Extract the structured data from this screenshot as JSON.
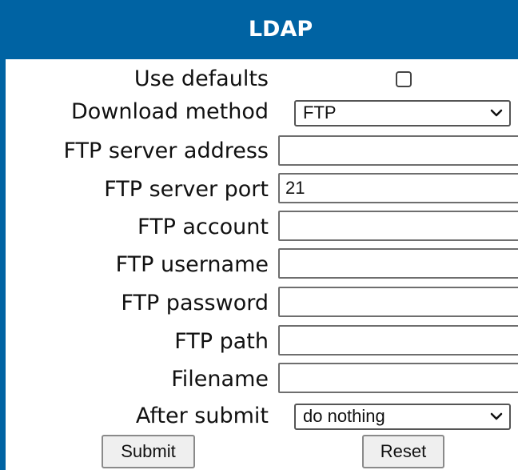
{
  "title": "LDAP",
  "form": {
    "use_defaults_label": "Use defaults",
    "use_defaults_checked": false,
    "download_method_label": "Download method",
    "download_method_value": "FTP",
    "ftp_server_address_label": "FTP server address",
    "ftp_server_address_value": "",
    "ftp_server_port_label": "FTP server port",
    "ftp_server_port_value": "21",
    "ftp_account_label": "FTP account",
    "ftp_account_value": "",
    "ftp_username_label": "FTP username",
    "ftp_username_value": "",
    "ftp_password_label": "FTP password",
    "ftp_password_value": "",
    "ftp_path_label": "FTP path",
    "ftp_path_value": "",
    "filename_label": "Filename",
    "filename_value": "",
    "after_submit_label": "After submit",
    "after_submit_value": "do nothing"
  },
  "buttons": {
    "submit_label": "Submit",
    "reset_label": "Reset"
  },
  "colors": {
    "header_background": "#0063a3",
    "header_text": "#ffffff"
  },
  "icons": {
    "select_arrow": "chevron-down-icon"
  }
}
